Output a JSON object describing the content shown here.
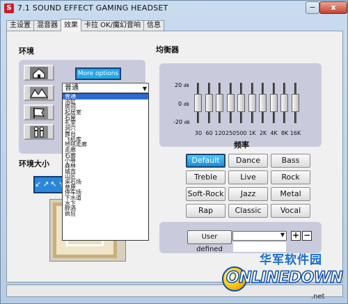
{
  "window": {
    "title": "7.1 SOUND EFFECT GAMING HEADSET",
    "app_icon": "S",
    "min": "−",
    "close": "x"
  },
  "tabs": [
    "主设置",
    "混音器",
    "效果",
    "卡拉 OK/魔幻音响",
    "信息"
  ],
  "active_tab": 2,
  "environment": {
    "title": "环境",
    "more_options": "More options",
    "selected": "普通",
    "options": [
      "普通",
      "浴缸",
      "房间",
      "起居室",
      "石屋",
      "礼堂",
      "洞穴",
      "舞台",
      "飞机库",
      "地毯走廊",
      "走廊",
      "石廊",
      "小巷",
      "森林",
      "城市",
      "山区",
      "采石场",
      "草原",
      "停车场",
      "下水道",
      "水下",
      "醉酒",
      "疯狂"
    ],
    "icons": [
      "house-icon",
      "sea-icon",
      "flag-icon",
      "people-icon"
    ]
  },
  "env_size": {
    "title": "环境大小",
    "control": "↙↗↖↘"
  },
  "equalizer": {
    "title": "均衡器",
    "db_top": "20",
    "db_mid": "0",
    "db_bottom": "-20",
    "db_unit": "dB",
    "freq_title": "频率",
    "bands": [
      "30",
      "60",
      "120",
      "250",
      "500",
      "1K",
      "2K",
      "4K",
      "8K",
      "16K"
    ],
    "levels_db": [
      0,
      0,
      0,
      0,
      0,
      0,
      0,
      0,
      0,
      0
    ],
    "presets": [
      "Default",
      "Dance",
      "Bass",
      "Treble",
      "Live",
      "Rock",
      "Soft-Rock",
      "Jazz",
      "Metal",
      "Rap",
      "Classic",
      "Vocal"
    ],
    "active_preset": "Default"
  },
  "user_defined": {
    "label": "User defined",
    "plus": "+",
    "minus": "−"
  },
  "watermark": {
    "cn": "华军软件园",
    "en": "ONLINEDOWN",
    "dotnet": ".net"
  }
}
